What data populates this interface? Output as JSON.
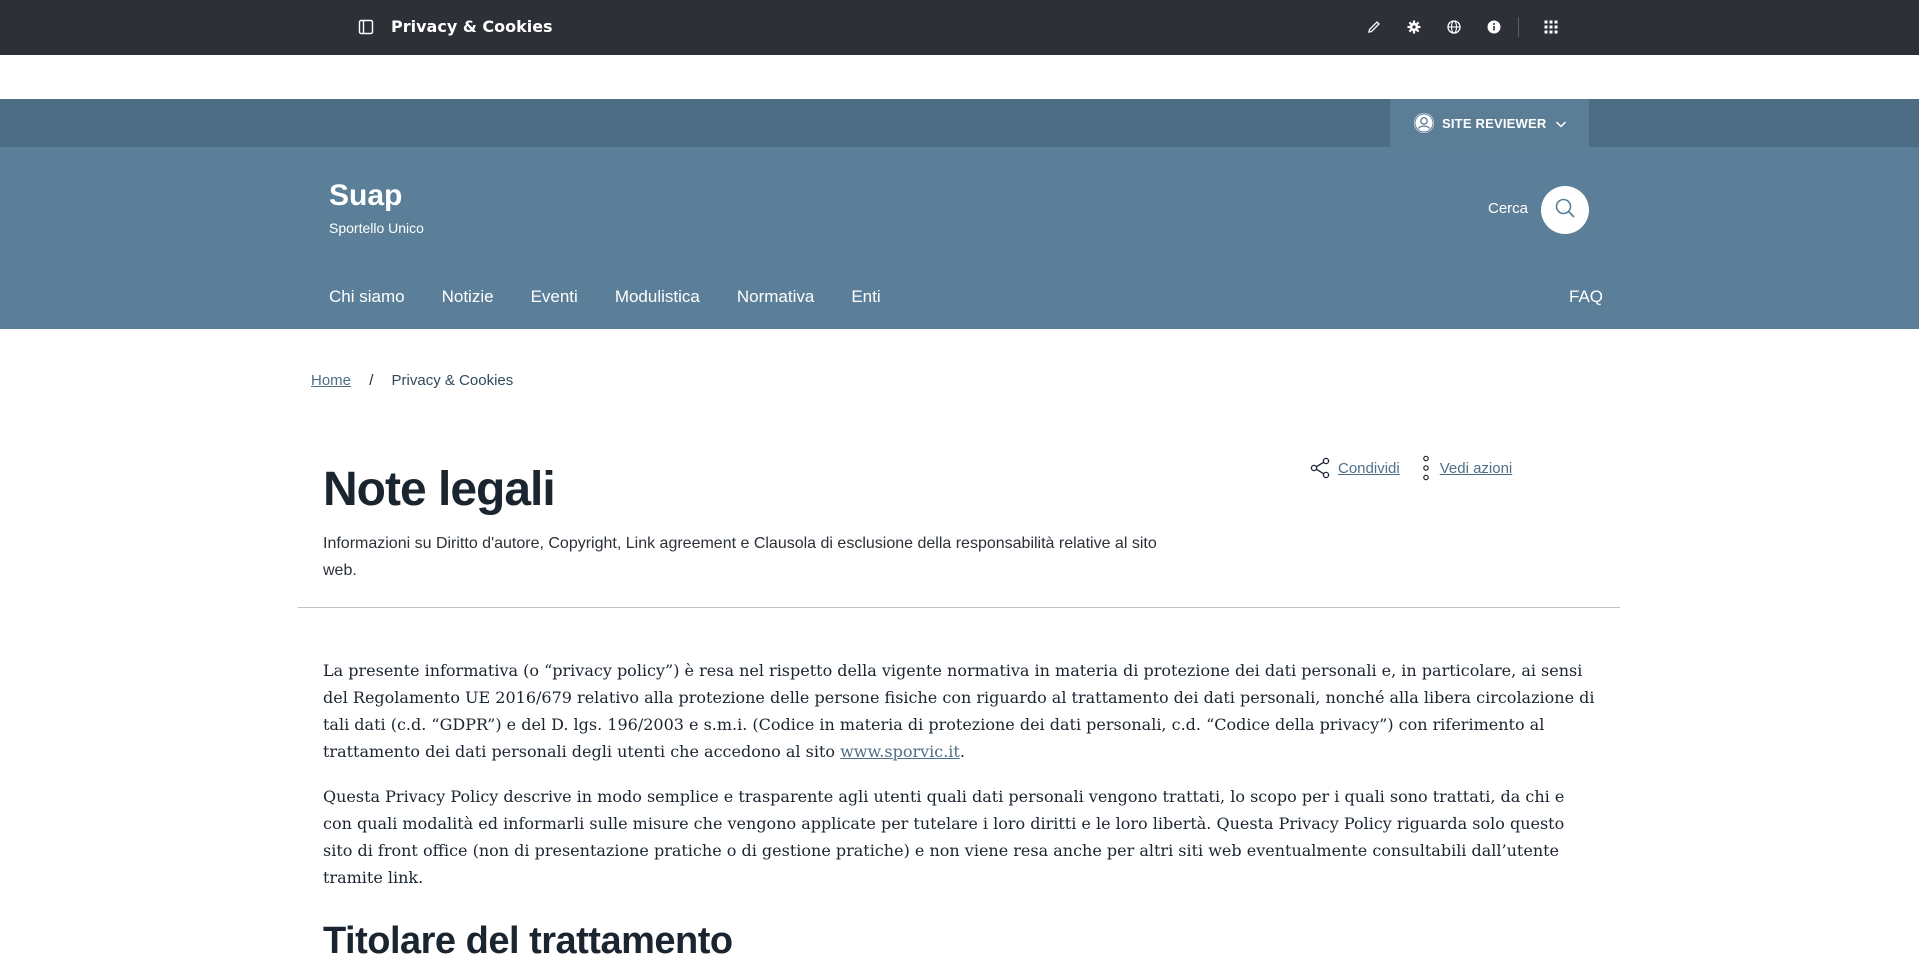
{
  "cms_toolbar": {
    "page_label": "Privacy & Cookies",
    "tools": [
      "edit-icon",
      "settings-icon",
      "language-icon",
      "info-icon",
      "apps-grid-icon"
    ]
  },
  "slim_header": {
    "user_label": "SITE REVIEWER"
  },
  "header": {
    "brand_title": "Suap",
    "brand_subtitle": "Sportello Unico",
    "search_label": "Cerca"
  },
  "nav": {
    "items": [
      "Chi siamo",
      "Notizie",
      "Eventi",
      "Modulistica",
      "Normativa",
      "Enti"
    ],
    "faq": "FAQ"
  },
  "breadcrumb": {
    "home": "Home",
    "separator": "/",
    "current": "Privacy & Cookies"
  },
  "page": {
    "title": "Note legali",
    "description": "Informazioni su Diritto d'autore, Copyright, Link agreement e Clausola di esclusione della responsabilità relative al sito web.",
    "share_label": "Condividi",
    "actions_label": "Vedi azioni"
  },
  "content": {
    "p1_before_link": "La presente informativa (o “privacy policy”) è resa nel rispetto della vigente normativa in materia di protezione dei dati personali e, in particolare, ai sensi del Regolamento UE 2016/679 relativo alla protezione delle persone fisiche con riguardo al trattamento dei dati personali, nonché alla libera circolazione di tali dati (c.d. “GDPR”) e del D. lgs. 196/2003 e s.m.i. (Codice in materia di protezione dei dati personali, c.d. “Codice della privacy”) con riferimento al trattamento dei dati personali degli utenti che accedono al sito ",
    "p1_link": "www.sporvic.it",
    "p1_after_link": ".",
    "p2": "Questa Privacy Policy descrive in modo semplice e trasparente agli utenti quali dati personali vengono trattati, lo scopo per i quali sono trattati, da chi e con quali modalità ed informarli sulle misure che vengono applicate per tutelare i loro diritti e le loro libertà. Questa Privacy Policy riguarda solo questo sito di front office (non di presentazione pratiche o di gestione pratiche) e non viene resa anche per altri siti web eventualmente consultabili dall’utente tramite link.",
    "section_title": "Titolare del trattamento"
  },
  "colors": {
    "cms_bar": "#2e3038",
    "slim_header": "#4d6d84",
    "center_header": "#5b7f98",
    "link": "#4f6f87"
  }
}
